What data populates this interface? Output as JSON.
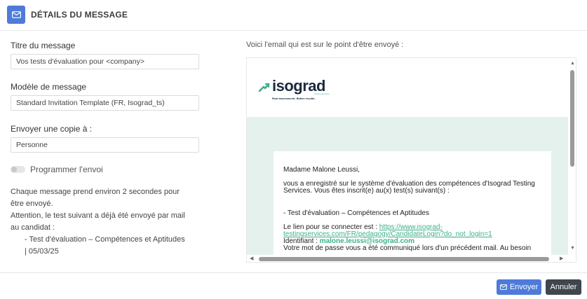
{
  "header": {
    "icon": "envelope-icon",
    "title": "DÉTAILS DU MESSAGE",
    "accent_color": "#4e7bd9"
  },
  "form": {
    "subject_label": "Titre du message",
    "subject_value": "Vos tests d'évaluation pour <company>",
    "template_label": "Modèle de message",
    "template_value": "Standard Invitation Template (FR, Isograd_ts)",
    "cc_label": "Envoyer une copie à :",
    "cc_value": "Personne",
    "schedule_label": "Programmer l'envoi",
    "schedule_enabled": false
  },
  "info": {
    "line1": "Chaque message prend environ 2 secondes pour être envoyé.",
    "line2": "Attention, le test suivant a déjà été envoyé par mail au candidat :",
    "items": [
      "- Test d'évaluation – Compétences et Aptitudes | 05/03/25"
    ]
  },
  "preview": {
    "title": "Voici l'email qui est sur le point d'être envoyé :",
    "logo_text": "isograd",
    "logo_sub": "Testing Services",
    "logo_tagline": "Real assessment. Better results.",
    "greeting": "Madame Malone Leussi,",
    "intro": "vous a enregistré sur le système d'évaluation des compétences d'Isograd Testing Services. Vous êtes inscrit(e) au(x) test(s) suivant(s) :",
    "test_item": "- Test d'évaluation – Compétences et Aptitudes",
    "link_label": "Le lien pour se connecter est :",
    "link_url": "https://www.isograd-testingservices.com/FR/pedagogy/CandidateLogin?do_not_login=1",
    "id_label": "Identifiant :",
    "id_value": "malone.leussi@isograd.com",
    "password_text": "Votre mot de passe vous a été communiqué lors d'un précédent mail. Au besoin",
    "brand_green": "#3db088",
    "body_bg": "#e5f1ec"
  },
  "footer": {
    "send_label": "Envoyer",
    "send_icon": "envelope-icon",
    "cancel_label": "Annuler"
  }
}
